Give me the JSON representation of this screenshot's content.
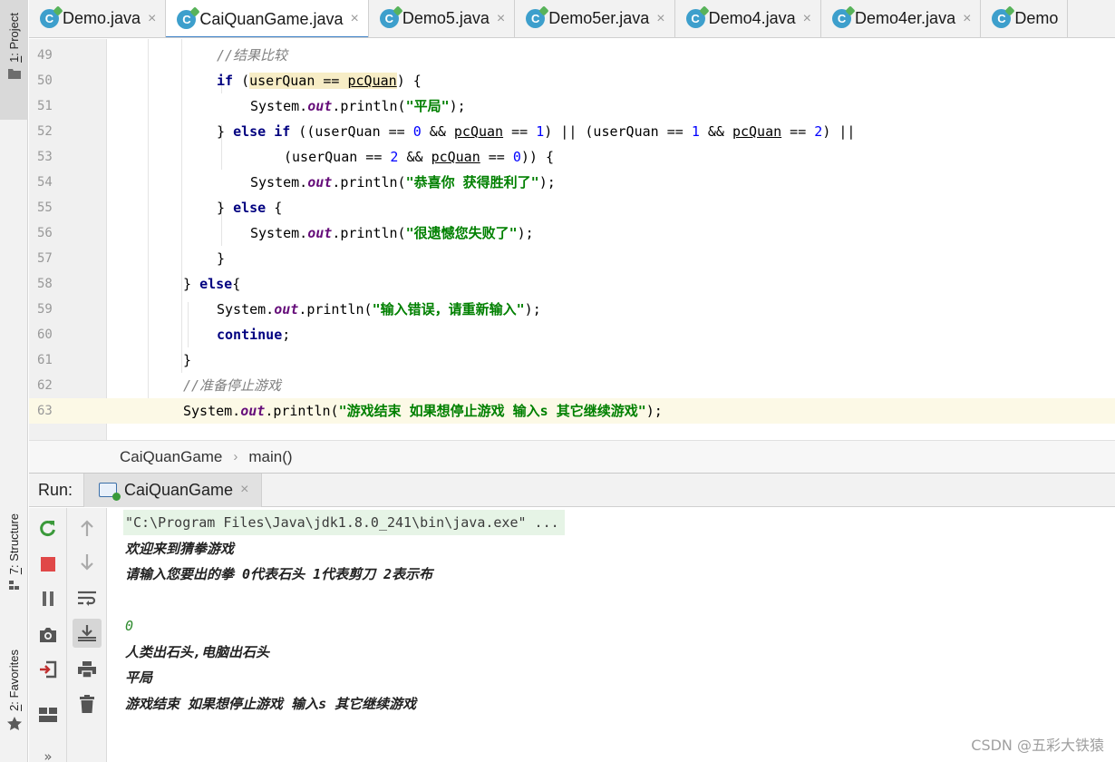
{
  "sidebar": {
    "project_num": "1",
    "project_label": ": Project",
    "structure_num": "7",
    "structure_label": ": Structure",
    "favorites_num": "2",
    "favorites_label": ": Favorites"
  },
  "tabs": [
    {
      "label": "Demo.java",
      "active": false
    },
    {
      "label": "CaiQuanGame.java",
      "active": true
    },
    {
      "label": "Demo5.java",
      "active": false
    },
    {
      "label": "Demo5er.java",
      "active": false
    },
    {
      "label": "Demo4.java",
      "active": false
    },
    {
      "label": "Demo4er.java",
      "active": false
    },
    {
      "label": "Demo",
      "active": false
    }
  ],
  "tab_icon_letter": "C",
  "close_glyph": "×",
  "editor": {
    "lines": [
      {
        "n": "49",
        "indent": 3,
        "text": "//结果比较"
      },
      {
        "n": "50",
        "indent": 3,
        "text": "if (userQuan == pcQuan) {"
      },
      {
        "n": "51",
        "indent": 4,
        "text": "System.out.println(\"平局\");"
      },
      {
        "n": "52",
        "indent": 3,
        "text": "} else if ((userQuan == 0 && pcQuan == 1) || (userQuan == 1 && pcQuan == 2) ||"
      },
      {
        "n": "53",
        "indent": 5,
        "text": "(userQuan == 2 && pcQuan == 0)) {"
      },
      {
        "n": "54",
        "indent": 4,
        "text": "System.out.println(\"恭喜你 获得胜利了\");"
      },
      {
        "n": "55",
        "indent": 3,
        "text": "} else {"
      },
      {
        "n": "56",
        "indent": 4,
        "text": "System.out.println(\"很遗憾您失败了\");"
      },
      {
        "n": "57",
        "indent": 3,
        "text": "}"
      },
      {
        "n": "58",
        "indent": 2,
        "text": "} else{"
      },
      {
        "n": "59",
        "indent": 3,
        "text": "System.out.println(\"输入错误，请重新输入\");"
      },
      {
        "n": "60",
        "indent": 3,
        "text": "continue;"
      },
      {
        "n": "61",
        "indent": 2,
        "text": "}"
      },
      {
        "n": "62",
        "indent": 2,
        "text": "//准备停止游戏"
      },
      {
        "n": "63",
        "indent": 2,
        "text": "System.out.println(\"游戏结束 如果想停止游戏 输入s 其它继续游戏\");"
      }
    ],
    "current_line": "63"
  },
  "breadcrumb": {
    "class_name": "CaiQuanGame",
    "separator": "›",
    "method": "main()"
  },
  "run": {
    "label": "Run:",
    "tab_label": "CaiQuanGame",
    "console_lines": [
      {
        "text": "\"C:\\Program Files\\Java\\jdk1.8.0_241\\bin\\java.exe\" ...",
        "kind": "cmd"
      },
      {
        "text": "欢迎来到猜拳游戏",
        "kind": "out"
      },
      {
        "text": "请输入您要出的拳 0代表石头 1代表剪刀 2表示布",
        "kind": "out"
      },
      {
        "text": "",
        "kind": "out"
      },
      {
        "text": "0",
        "kind": "input"
      },
      {
        "text": "人类出石头,电脑出石头",
        "kind": "out"
      },
      {
        "text": "平局",
        "kind": "out"
      },
      {
        "text": "游戏结束 如果想停止游戏 输入s 其它继续游戏",
        "kind": "out"
      }
    ]
  },
  "watermark": "CSDN @五彩大铁猿",
  "more_glyph": "»",
  "colors": {
    "keyword": "#000080",
    "string": "#008000",
    "comment": "#808080",
    "number": "#0000ff",
    "field": "#660e7a",
    "accent": "#4083c9"
  }
}
